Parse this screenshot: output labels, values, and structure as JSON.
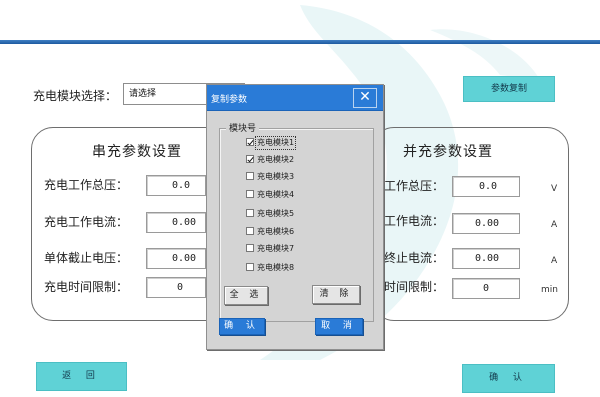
{
  "header": {
    "module_select_label": "充电模块选择：",
    "module_select_value": "请选择",
    "copy_params_label": "参数复制"
  },
  "serial": {
    "title": "串充参数设置",
    "rows": [
      {
        "label": "充电工作总压：",
        "value": "0.0"
      },
      {
        "label": "充电工作电流：",
        "value": "0.00"
      },
      {
        "label": "单体截止电压：",
        "value": "0.00"
      },
      {
        "label": "充电时间限制：",
        "value": "0"
      }
    ]
  },
  "parallel": {
    "title": "并充参数设置",
    "rows": [
      {
        "label": "工作总压：",
        "value": "0.0",
        "unit": "V"
      },
      {
        "label": "工作电流：",
        "value": "0.00",
        "unit": "A"
      },
      {
        "label": "终止电流：",
        "value": "0.00",
        "unit": "A"
      },
      {
        "label": "时间限制：",
        "value": "0",
        "unit": "min"
      }
    ]
  },
  "dialog": {
    "title": "复制参数",
    "close_glyph": "✕",
    "group_label": "模块号",
    "modules": [
      {
        "label": "充电模块1",
        "checked": true
      },
      {
        "label": "充电模块2",
        "checked": true
      },
      {
        "label": "充电模块3",
        "checked": false
      },
      {
        "label": "充电模块4",
        "checked": false
      },
      {
        "label": "充电模块5",
        "checked": false
      },
      {
        "label": "充电模块6",
        "checked": false
      },
      {
        "label": "充电模块7",
        "checked": false
      },
      {
        "label": "充电模块8",
        "checked": false
      }
    ],
    "select_all_label": "全 选",
    "clear_label": "清 除",
    "ok_label": "确 认",
    "cancel_label": "取 消"
  },
  "footer": {
    "back_label": "返 回",
    "confirm_label": "确 认"
  },
  "colors": {
    "accent_teal": "#5fd2d6",
    "dialog_blue": "#2a7bd7",
    "top_line": "#2a6db5"
  }
}
